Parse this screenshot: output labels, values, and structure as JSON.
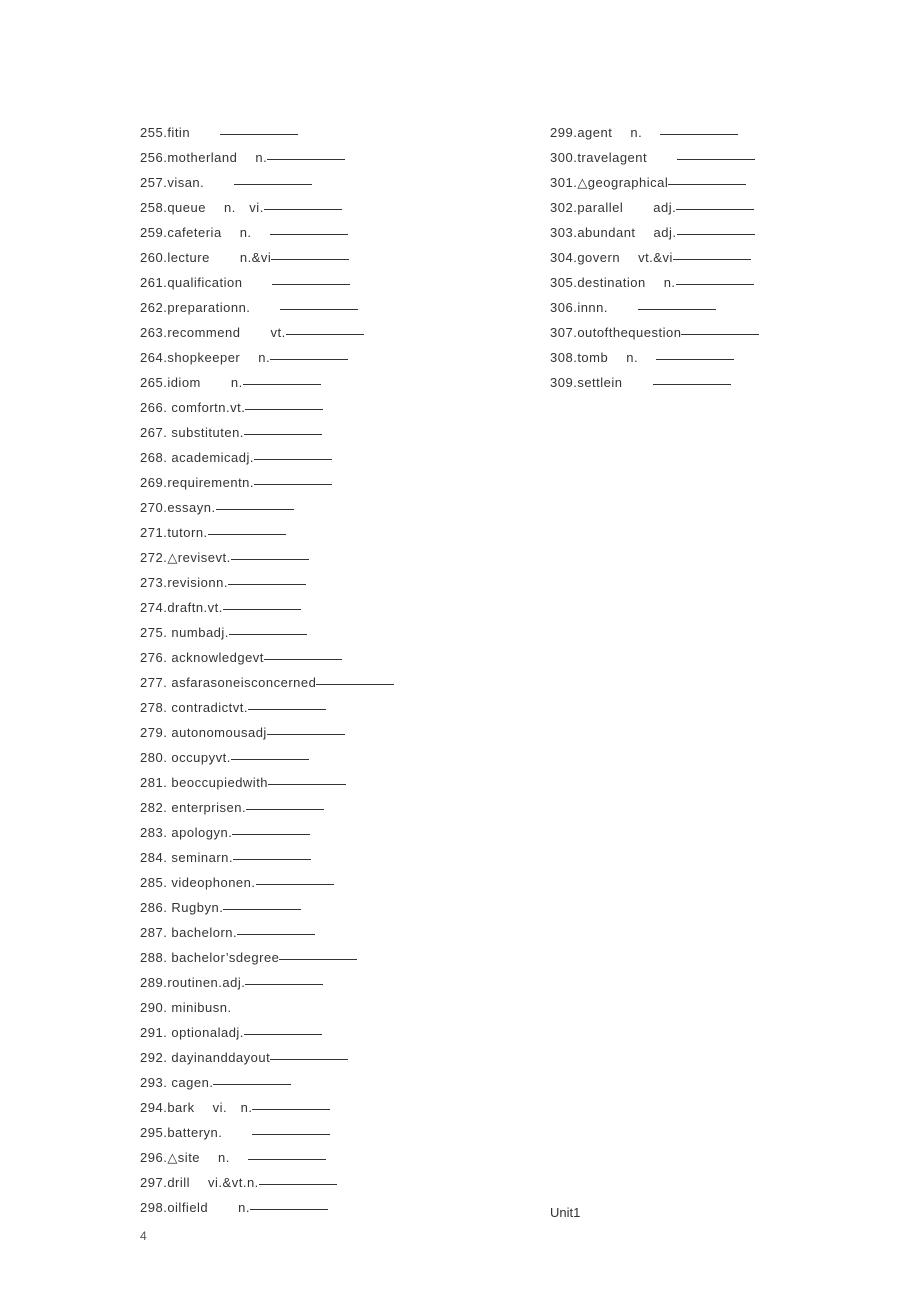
{
  "left": [
    {
      "num": "255.",
      "word": "fitin",
      "pos": "",
      "gapBeforePos": "",
      "gapAfterPos": "large"
    },
    {
      "num": "256.",
      "word": "motherland",
      "pos": "n.",
      "gapBeforePos": "med",
      "gapAfterPos": ""
    },
    {
      "num": "257.",
      "word": "visan.",
      "pos": "",
      "gapBeforePos": "",
      "gapAfterPos": "large"
    },
    {
      "num": "258.",
      "word": "queue",
      "pos": "n. vi.",
      "gapBeforePos": "med",
      "gapAfterPos": ""
    },
    {
      "num": "259.",
      "word": "cafeteria",
      "pos": "n.",
      "gapBeforePos": "med",
      "gapAfterPos": "med"
    },
    {
      "num": "260.",
      "word": "lecture",
      "pos": "n.&vi",
      "gapBeforePos": "large",
      "gapAfterPos": ""
    },
    {
      "num": "261.",
      "word": "qualification",
      "pos": "",
      "gapBeforePos": "",
      "gapAfterPos": "large"
    },
    {
      "num": "262.",
      "word": "preparationn.",
      "pos": "",
      "gapBeforePos": "",
      "gapAfterPos": "large"
    },
    {
      "num": "263.",
      "word": "recommend",
      "pos": "vt.",
      "gapBeforePos": "large",
      "gapAfterPos": ""
    },
    {
      "num": "264.",
      "word": "shopkeeper",
      "pos": "n.",
      "gapBeforePos": "med",
      "gapAfterPos": ""
    },
    {
      "num": "265.",
      "word": "idiom",
      "pos": "n.",
      "gapBeforePos": "large",
      "gapAfterPos": ""
    },
    {
      "num": "266. ",
      "word": "comfortn.vt.",
      "pos": "",
      "gapBeforePos": "",
      "gapAfterPos": ""
    },
    {
      "num": "267. ",
      "word": "substituten.",
      "pos": "",
      "gapBeforePos": "",
      "gapAfterPos": ""
    },
    {
      "num": "268. ",
      "word": "academicadj.",
      "pos": "",
      "gapBeforePos": "",
      "gapAfterPos": ""
    },
    {
      "num": "269.",
      "word": "requirementn.",
      "pos": "",
      "gapBeforePos": "",
      "gapAfterPos": ""
    },
    {
      "num": "270.",
      "word": "essayn.",
      "pos": "",
      "gapBeforePos": "",
      "gapAfterPos": ""
    },
    {
      "num": "271.",
      "word": "tutorn.",
      "pos": "",
      "gapBeforePos": "",
      "gapAfterPos": ""
    },
    {
      "num": "272.",
      "word": "△revisevt.",
      "pos": "",
      "gapBeforePos": "",
      "gapAfterPos": ""
    },
    {
      "num": "273.",
      "word": "revisionn.",
      "pos": "",
      "gapBeforePos": "",
      "gapAfterPos": ""
    },
    {
      "num": "274.",
      "word": "draftn.vt.",
      "pos": "",
      "gapBeforePos": "",
      "gapAfterPos": ""
    },
    {
      "num": "275. ",
      "word": "numbadj.",
      "pos": "",
      "gapBeforePos": "",
      "gapAfterPos": ""
    },
    {
      "num": "276. ",
      "word": "acknowledgevt",
      "pos": "",
      "gapBeforePos": "",
      "gapAfterPos": ""
    },
    {
      "num": "277. ",
      "word": "asfarasoneisconcerned",
      "pos": "",
      "gapBeforePos": "",
      "gapAfterPos": ""
    },
    {
      "num": "278. ",
      "word": "contradictvt.",
      "pos": "",
      "gapBeforePos": "",
      "gapAfterPos": ""
    },
    {
      "num": "279. ",
      "word": "autonomousadj",
      "pos": "",
      "gapBeforePos": "",
      "gapAfterPos": ""
    },
    {
      "num": "280. ",
      "word": "occupyvt.",
      "pos": "",
      "gapBeforePos": "",
      "gapAfterPos": ""
    },
    {
      "num": "281. ",
      "word": "beoccupiedwith",
      "pos": "",
      "gapBeforePos": "",
      "gapAfterPos": ""
    },
    {
      "num": "282. ",
      "word": "enterprisen.",
      "pos": "",
      "gapBeforePos": "",
      "gapAfterPos": ""
    },
    {
      "num": "283. ",
      "word": "apologyn.",
      "pos": "",
      "gapBeforePos": "",
      "gapAfterPos": ""
    },
    {
      "num": "284. ",
      "word": "seminarn.",
      "pos": "",
      "gapBeforePos": "",
      "gapAfterPos": ""
    },
    {
      "num": "285. ",
      "word": "videophonen.",
      "pos": "",
      "gapBeforePos": "",
      "gapAfterPos": ""
    },
    {
      "num": "286. ",
      "word": "Rugbyn.",
      "pos": "",
      "gapBeforePos": "",
      "gapAfterPos": ""
    },
    {
      "num": "287. ",
      "word": "bachelorn.",
      "pos": "",
      "gapBeforePos": "",
      "gapAfterPos": ""
    },
    {
      "num": "288. ",
      "word": "bachelor’sdegree",
      "pos": "",
      "gapBeforePos": "",
      "gapAfterPos": ""
    },
    {
      "num": "289.",
      "word": "routinen.adj.",
      "pos": "",
      "gapBeforePos": "",
      "gapAfterPos": ""
    },
    {
      "num": "290. ",
      "word": "minibusn.",
      "pos": "",
      "gapBeforePos": "",
      "gapAfterPos": "",
      "noBlank": true
    },
    {
      "num": "291. ",
      "word": "optionaladj.",
      "pos": "",
      "gapBeforePos": "",
      "gapAfterPos": ""
    },
    {
      "num": "292. ",
      "word": "dayinanddayout",
      "pos": "",
      "gapBeforePos": "",
      "gapAfterPos": ""
    },
    {
      "num": "293. ",
      "word": "cagen.",
      "pos": "",
      "gapBeforePos": "",
      "gapAfterPos": ""
    },
    {
      "num": "294.",
      "word": "bark",
      "pos": "vi. n.",
      "gapBeforePos": "med",
      "gapAfterPos": ""
    },
    {
      "num": "295.",
      "word": "batteryn.",
      "pos": "",
      "gapBeforePos": "",
      "gapAfterPos": "large"
    },
    {
      "num": "296.",
      "word": "△site",
      "pos": "n.",
      "gapBeforePos": "med",
      "gapAfterPos": "med"
    },
    {
      "num": "297.",
      "word": "drill",
      "pos": "vi.&vt.n.",
      "gapBeforePos": "med",
      "gapAfterPos": ""
    },
    {
      "num": "298.",
      "word": "oilfield",
      "pos": "n.",
      "gapBeforePos": "large",
      "gapAfterPos": ""
    }
  ],
  "right": [
    {
      "num": "299.",
      "word": "agent",
      "pos": "n.",
      "gapBeforePos": "med",
      "gapAfterPos": "med"
    },
    {
      "num": "300.",
      "word": "travelagent",
      "pos": "",
      "gapBeforePos": "",
      "gapAfterPos": "large"
    },
    {
      "num": "301.",
      "word": "△geographical",
      "pos": "",
      "gapBeforePos": "",
      "gapAfterPos": ""
    },
    {
      "num": "302.",
      "word": "parallel",
      "pos": "adj.",
      "gapBeforePos": "large",
      "gapAfterPos": ""
    },
    {
      "num": "303.",
      "word": "abundant",
      "pos": "adj.",
      "gapBeforePos": "med",
      "gapAfterPos": ""
    },
    {
      "num": "304.",
      "word": "govern",
      "pos": "vt.&vi",
      "gapBeforePos": "med",
      "gapAfterPos": ""
    },
    {
      "num": "305.",
      "word": "destination",
      "pos": "n.",
      "gapBeforePos": "med",
      "gapAfterPos": ""
    },
    {
      "num": "306.",
      "word": "innn.",
      "pos": "",
      "gapBeforePos": "",
      "gapAfterPos": "large"
    },
    {
      "num": "307.",
      "word": "outofthequestion",
      "pos": "",
      "gapBeforePos": "",
      "gapAfterPos": ""
    },
    {
      "num": "308.",
      "word": "tomb",
      "pos": "n.",
      "gapBeforePos": "med",
      "gapAfterPos": "med"
    },
    {
      "num": "309.",
      "word": "settlein",
      "pos": "",
      "gapBeforePos": "",
      "gapAfterPos": "large"
    }
  ],
  "unitLabel": "Unit1",
  "pageNumber": "4"
}
